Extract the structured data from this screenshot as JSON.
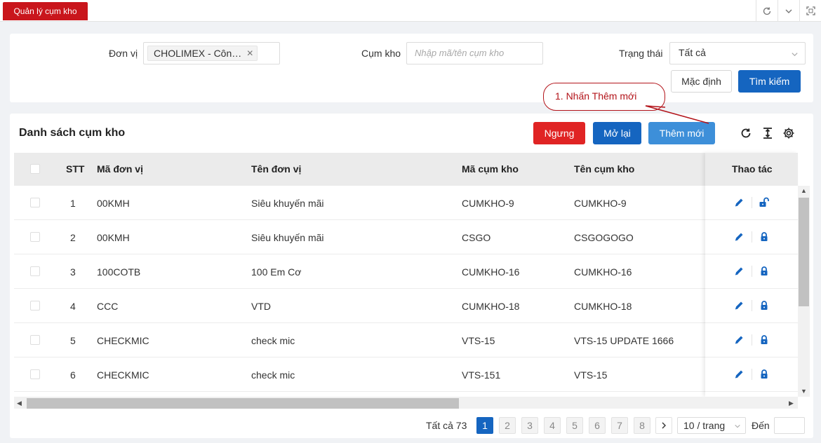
{
  "topbar": {
    "tab_label": "Quản lý cụm kho"
  },
  "filters": {
    "unit_label": "Đơn vị",
    "unit_tag": "CHOLIMEX - Côn…",
    "cluster_label": "Cụm kho",
    "cluster_placeholder": "Nhập mã/tên cụm kho",
    "status_label": "Trạng thái",
    "status_value": "Tất cả",
    "default_button": "Mặc định",
    "search_button": "Tìm kiếm"
  },
  "callout": {
    "text": "1. Nhấn Thêm mới"
  },
  "list": {
    "title": "Danh sách cụm kho",
    "stop_button": "Ngưng",
    "reopen_button": "Mở lại",
    "add_button": "Thêm mới"
  },
  "table": {
    "headers": {
      "stt": "STT",
      "unit_code": "Mã đơn vị",
      "unit_name": "Tên đơn vị",
      "cluster_code": "Mã cụm kho",
      "cluster_name": "Tên cụm kho",
      "actions": "Thao tác"
    },
    "rows": [
      {
        "stt": "1",
        "unit_code": "00KMH",
        "unit_name": "Siêu khuyến mãi",
        "cluster_code": "CUMKHO-9",
        "cluster_name": "CUMKHO-9",
        "lock_icon": "unlock-icon"
      },
      {
        "stt": "2",
        "unit_code": "00KMH",
        "unit_name": "Siêu khuyến mãi",
        "cluster_code": "CSGO",
        "cluster_name": "CSGOGOGO",
        "lock_icon": "lock-icon"
      },
      {
        "stt": "3",
        "unit_code": "100COTB",
        "unit_name": "100 Em Cơ",
        "cluster_code": "CUMKHO-16",
        "cluster_name": "CUMKHO-16",
        "lock_icon": "lock-icon"
      },
      {
        "stt": "4",
        "unit_code": "CCC",
        "unit_name": "VTD",
        "cluster_code": "CUMKHO-18",
        "cluster_name": "CUMKHO-18",
        "lock_icon": "lock-icon"
      },
      {
        "stt": "5",
        "unit_code": "CHECKMIC",
        "unit_name": "check mic",
        "cluster_code": "VTS-15",
        "cluster_name": "VTS-15 UPDATE 1666",
        "lock_icon": "lock-icon"
      },
      {
        "stt": "6",
        "unit_code": "CHECKMIC",
        "unit_name": "check mic",
        "cluster_code": "VTS-151",
        "cluster_name": "VTS-15",
        "lock_icon": "lock-icon"
      }
    ]
  },
  "pagination": {
    "total": "Tất cả 73",
    "pages": [
      "1",
      "2",
      "3",
      "4",
      "5",
      "6",
      "7",
      "8"
    ],
    "current": "1",
    "page_size": "10 / trang",
    "goto_label": "Đến"
  },
  "colors": {
    "brand_red": "#c9161c",
    "primary_blue": "#1565c0",
    "danger_red": "#e02424",
    "light_blue": "#3d8fd9"
  }
}
